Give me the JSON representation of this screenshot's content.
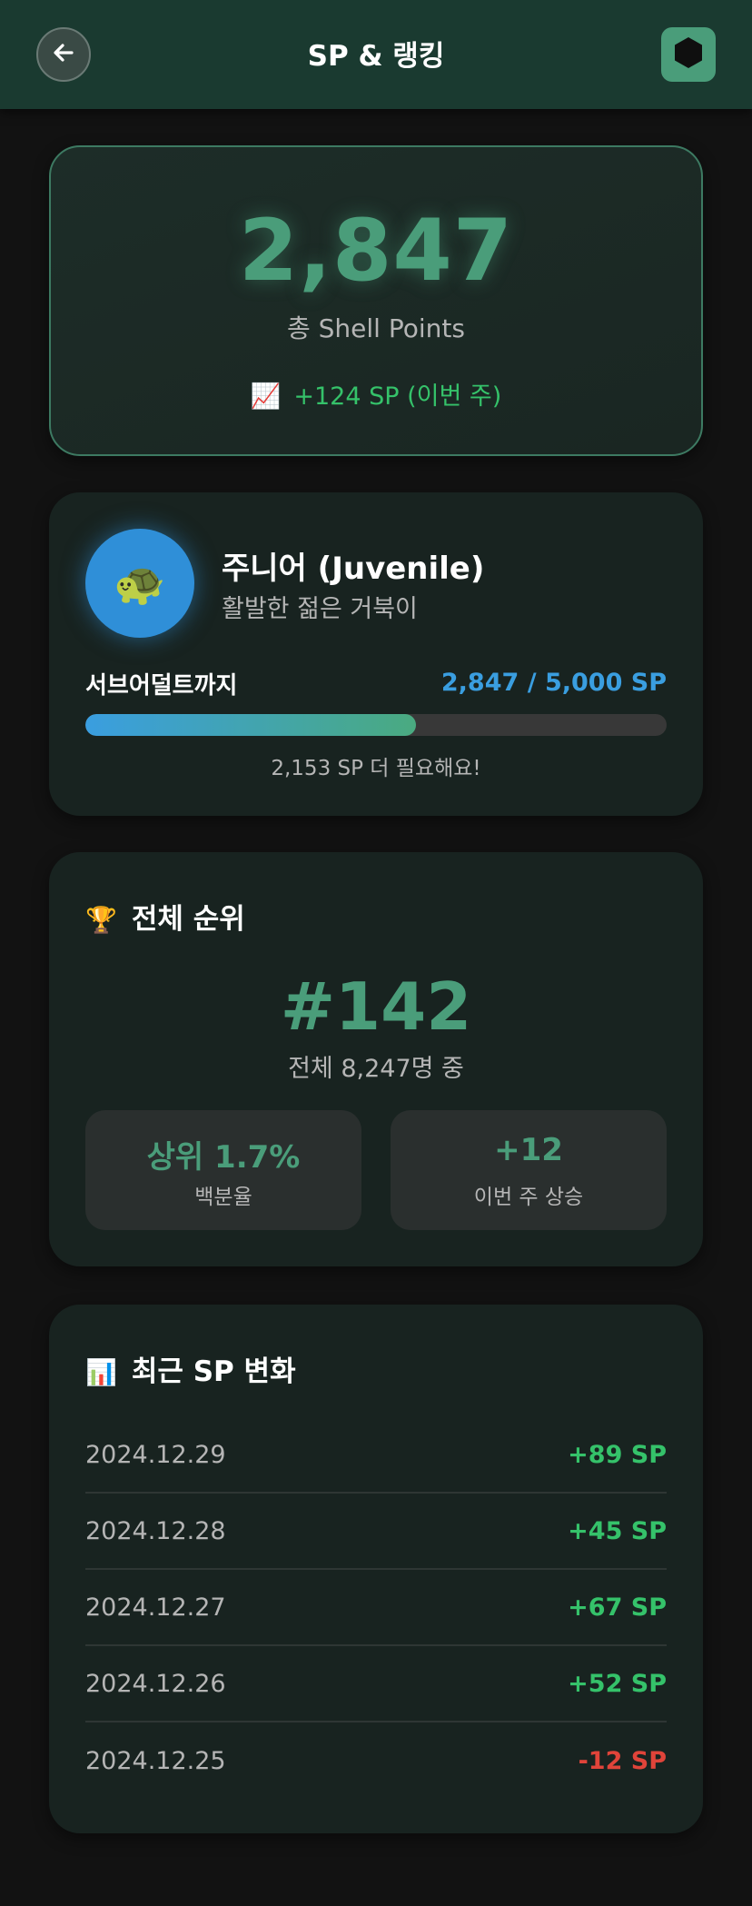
{
  "header": {
    "title": "SP & 랭킹",
    "back_icon": "arrow-left-icon",
    "logo_icon": "hexagon-icon"
  },
  "points": {
    "total": "2,847",
    "label": "총 Shell Points",
    "weekly_icon": "📈",
    "weekly": "+124 SP (이번 주)"
  },
  "level": {
    "avatar_icon": "🐢",
    "name": "주니어 (Juvenile)",
    "description": "활발한 젊은 거북이",
    "next_label": "서브어덜트까지",
    "progress_text": "2,847 / 5,000 SP",
    "progress_fraction": 0.5694,
    "remaining": "2,153 SP 더 필요해요!"
  },
  "ranking": {
    "title_icon": "🏆",
    "title": "전체 순위",
    "rank": "#142",
    "total": "전체 8,247명 중",
    "stats": [
      {
        "value": "상위 1.7%",
        "label": "백분율"
      },
      {
        "value": "+12",
        "label": "이번 주 상승"
      }
    ]
  },
  "history": {
    "title_icon": "📊",
    "title": "최근 SP 변화",
    "rows": [
      {
        "date": "2024.12.29",
        "amount": "+89 SP",
        "type": "pos"
      },
      {
        "date": "2024.12.28",
        "amount": "+45 SP",
        "type": "pos"
      },
      {
        "date": "2024.12.27",
        "amount": "+67 SP",
        "type": "pos"
      },
      {
        "date": "2024.12.26",
        "amount": "+52 SP",
        "type": "pos"
      },
      {
        "date": "2024.12.25",
        "amount": "-12 SP",
        "type": "neg"
      }
    ]
  },
  "colors": {
    "accent": "#4a9d7a",
    "header_bg": "#1a3a30",
    "positive": "#35c26a",
    "negative": "#e0443a",
    "progress_blue": "#3a9ee0"
  }
}
